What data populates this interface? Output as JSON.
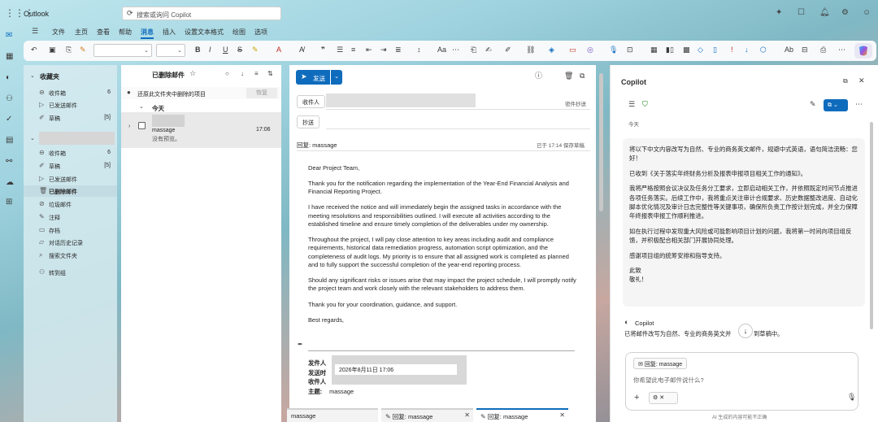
{
  "app": {
    "name": "Outlook"
  },
  "search": {
    "placeholder": "搜索或询问 Copilot"
  },
  "ribbon": {
    "tabs": [
      "文件",
      "主页",
      "查看",
      "帮助",
      "消息",
      "插入",
      "设置文本格式",
      "绘图",
      "选项"
    ],
    "active_tab": "消息"
  },
  "folders": {
    "favorites_label": "收藏夹",
    "favorites": [
      {
        "label": "收件箱",
        "count": "6"
      },
      {
        "label": "已发送邮件",
        "count": ""
      },
      {
        "label": "草稿",
        "count": "[5]"
      }
    ],
    "account": [
      {
        "label": "收件箱",
        "count": "6"
      },
      {
        "label": "草稿",
        "count": "[5]"
      },
      {
        "label": "已发送邮件",
        "count": ""
      },
      {
        "label": "已删除邮件",
        "count": "",
        "selected": true
      },
      {
        "label": "垃圾邮件",
        "count": ""
      },
      {
        "label": "注释",
        "count": ""
      },
      {
        "label": "存档",
        "count": ""
      },
      {
        "label": "对话历史记录",
        "count": ""
      },
      {
        "label": "搜索文件夹",
        "count": ""
      }
    ],
    "goto_groups": "转到组"
  },
  "message_list": {
    "title": "已删除邮件",
    "info": "还原此文件夹中删除的项目",
    "restore_btn": "恢复",
    "group_today": "今天",
    "item": {
      "subject": "massage",
      "preview": "没有预览。",
      "time": "17:06"
    }
  },
  "compose": {
    "send_label": "发送",
    "to_label": "收件人",
    "cc_label": "抄送",
    "bcc_label": "密件抄送",
    "subject": "回复: massage",
    "saved_note": "已于 17:14 保存草稿",
    "body": [
      "Dear Project Team,",
      "Thank you for the notification regarding the implementation of the Year-End Financial Analysis and Financial Reporting Project.",
      "I have received the notice and will immediately begin the assigned tasks in accordance with the meeting resolutions and responsibilities outlined. I will execute all activities according to the established timeline and ensure timely completion of the deliverables under my ownership.",
      "Throughout the project, I will pay close attention to key areas including audit and compliance requirements, historical data remediation progress, automation script optimization, and the completeness of audit logs. My priority is to ensure that all assigned work is completed as planned and to fully support the successful completion of the year-end reporting process.",
      "Should any significant risks or issues arise that may impact the project schedule, I will promptly notify the project team and work closely with the relevant stakeholders to address them.",
      "Thank you for your coordination, guidance, and support.",
      "Best regards,"
    ],
    "quoted": {
      "from_label": "发件人",
      "sent_label": "发送时",
      "sent_value": "2026年8月11日 17:06",
      "to_label": "收件人",
      "subject_label": "主题:",
      "subject_value": "massage"
    }
  },
  "bottom_tabs": [
    {
      "label": "massage",
      "active": false
    },
    {
      "label": "回复: massage",
      "active": false
    },
    {
      "label": "回复: massage",
      "active": true
    }
  ],
  "copilot": {
    "title": "Copilot",
    "date_label": "今天",
    "user_message": [
      "将以下中文内容改写为自然、专业的商务英文邮件，规避中式英语，语句简洁流畅：您好！",
      "已收到《关于落实年终财务分析及报表申报项目相关工作的通知》。",
      "我将严格按照会议决议及任务分工要求，立即启动相关工作，并依照既定时间节点推进各项任务落实。后续工作中，我将重点关注审计合规要求、历史数据整改进度、自动化脚本优化情况及审计日志完整性等关键事项，确保所负责工作按计划完成，并全力保障年终报表申报工作顺利推进。",
      "如在执行过程中发现重大风险或可能影响项目计划的问题，我将第一时间向项目组反馈，并积极配合相关部门开展协同处理。",
      "感谢项目组的统筹安排和指导支持。",
      "此致",
      "敬礼！"
    ],
    "reply_name": "Copilot",
    "reply_text": "已将邮件改写为自然、专业的商务英文并",
    "reply_text_end": "到草稿中。",
    "context_chip": "回复: massage",
    "input_placeholder": "你希望此电子邮件说什么?",
    "disclaimer": "AI 生成的内容可能不正确"
  }
}
